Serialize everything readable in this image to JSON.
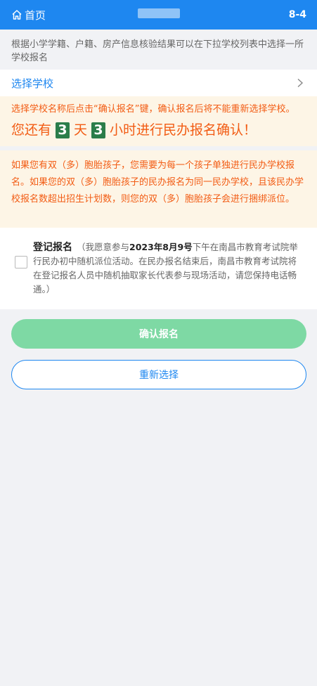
{
  "header": {
    "home_label": "首页",
    "page_number": "8-4",
    "accent_color": "#1e87f0"
  },
  "intro": {
    "text": "根据小学学籍、户籍、房产信息核验结果可以在下拉学校列表中选择一所学校报名"
  },
  "school_select": {
    "label": "选择学校",
    "icon": "chevron-right-icon"
  },
  "notice": {
    "instruction": "选择学校名称后点击“确认报名”键，确认报名后将不能重新选择学校。",
    "countdown_prefix": "您还有",
    "days": "3",
    "days_unit": "天",
    "hours": "3",
    "hours_suffix": "小时进行民办报名确认！"
  },
  "twins_notice": {
    "text": "如果您有双（多）胞胎孩子，您需要为每一个孩子单独进行民办学校报名。如果您的双（多）胞胎孩子的民办报名为同一民办学校，且该民办学校报名数超出招生计划数，则您的双（多）胞胎孩子会进行捆绑派位。"
  },
  "registration": {
    "title": "登记报名",
    "text_before_date": "（我愿意参与",
    "date": "2023年8月9号",
    "text_after_date": "下午在南昌市教育考试院举行民办初中随机派位活动。在民办报名结束后，南昌市教育考试院将在登记报名人员中随机抽取家长代表参与现场活动，请您保持电话畅通。）",
    "checked": false
  },
  "buttons": {
    "confirm_label": "确认报名",
    "reset_label": "重新选择"
  }
}
